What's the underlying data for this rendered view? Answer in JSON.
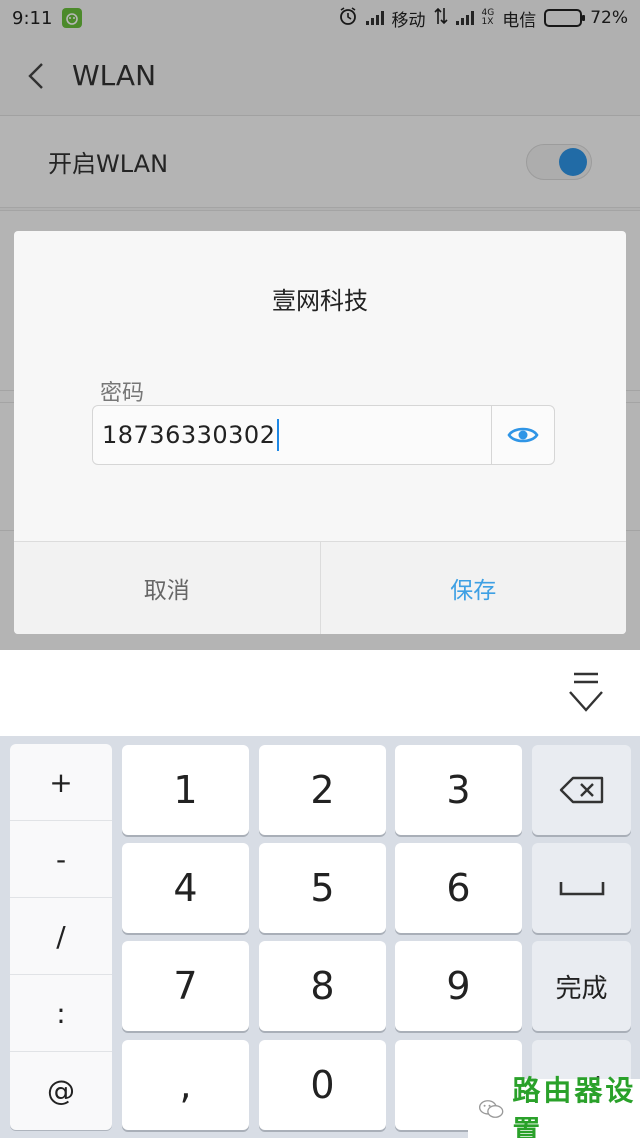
{
  "status_bar": {
    "time": "9:11",
    "carrier1": "移动",
    "carrier2": "电信",
    "net_badge": "4G",
    "net_badge2": "1X",
    "battery": "72%",
    "battery_level": 0.72
  },
  "header": {
    "title": "WLAN"
  },
  "wlan_toggle": {
    "label": "开启WLAN",
    "on": true
  },
  "dialog": {
    "title": "壹网科技",
    "password_label": "密码",
    "password_value": "18736330302",
    "cancel_label": "取消",
    "save_label": "保存"
  },
  "keyboard": {
    "symbols": [
      "+",
      "-",
      "/",
      ":",
      "@"
    ],
    "digits": [
      "1",
      "2",
      "3",
      "4",
      "5",
      "6",
      "7",
      "8",
      "9",
      ",",
      "0"
    ],
    "done_label": "完成"
  },
  "watermark": {
    "text": "路由器设置"
  },
  "colors": {
    "accent": "#2f95e6",
    "save_text": "#3ea0e4",
    "watermark": "#2aa12a"
  }
}
